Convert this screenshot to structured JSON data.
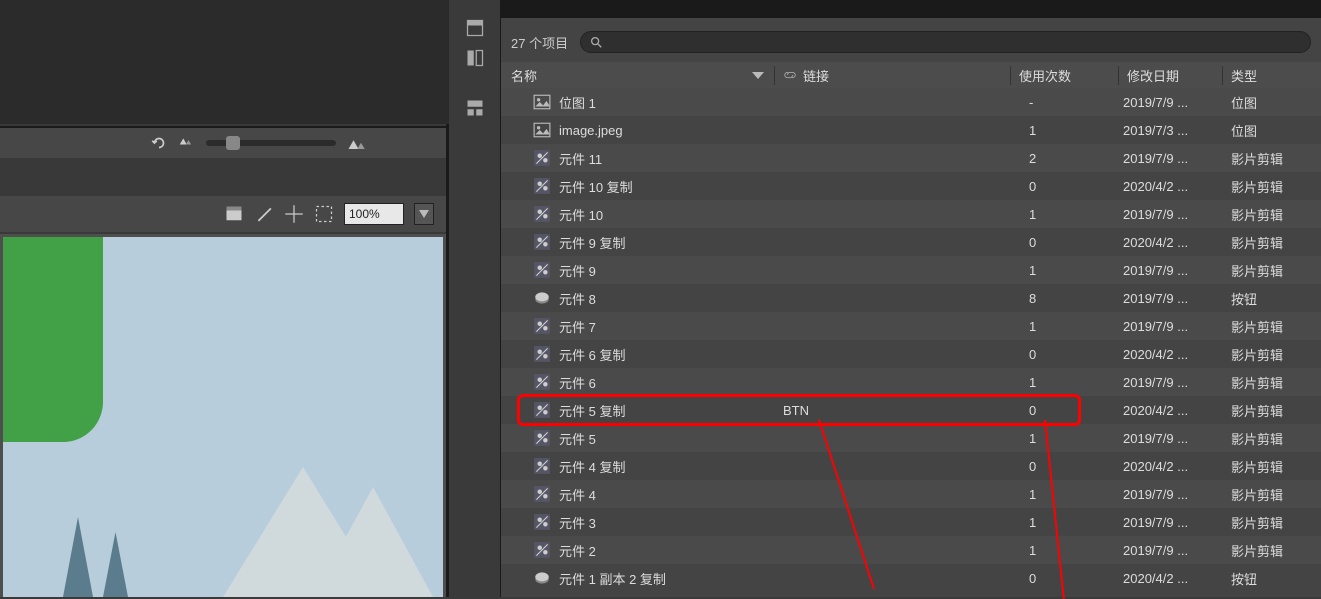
{
  "zoom": "100%",
  "library": {
    "item_count_label": "27 个项目",
    "search_placeholder": "",
    "columns": {
      "name": "名称",
      "link": "链接",
      "use": "使用次数",
      "date": "修改日期",
      "type": "类型"
    },
    "rows": [
      {
        "icon": "bitmap",
        "name": "位图 1",
        "link": "",
        "use": "-",
        "date": "2019/7/9 ...",
        "type": "位图"
      },
      {
        "icon": "bitmap",
        "name": "image.jpeg",
        "link": "",
        "use": "1",
        "date": "2019/7/3 ...",
        "type": "位图"
      },
      {
        "icon": "mc",
        "name": "元件 11",
        "link": "",
        "use": "2",
        "date": "2019/7/9 ...",
        "type": "影片剪辑"
      },
      {
        "icon": "mc",
        "name": "元件 10 复制",
        "link": "",
        "use": "0",
        "date": "2020/4/2 ...",
        "type": "影片剪辑"
      },
      {
        "icon": "mc",
        "name": "元件 10",
        "link": "",
        "use": "1",
        "date": "2019/7/9 ...",
        "type": "影片剪辑"
      },
      {
        "icon": "mc",
        "name": "元件 9 复制",
        "link": "",
        "use": "0",
        "date": "2020/4/2 ...",
        "type": "影片剪辑"
      },
      {
        "icon": "mc",
        "name": "元件 9",
        "link": "",
        "use": "1",
        "date": "2019/7/9 ...",
        "type": "影片剪辑"
      },
      {
        "icon": "btn",
        "name": "元件 8",
        "link": "",
        "use": "8",
        "date": "2019/7/9 ...",
        "type": "按钮"
      },
      {
        "icon": "mc",
        "name": "元件 7",
        "link": "",
        "use": "1",
        "date": "2019/7/9 ...",
        "type": "影片剪辑"
      },
      {
        "icon": "mc",
        "name": "元件 6 复制",
        "link": "",
        "use": "0",
        "date": "2020/4/2 ...",
        "type": "影片剪辑"
      },
      {
        "icon": "mc",
        "name": "元件 6",
        "link": "",
        "use": "1",
        "date": "2019/7/9 ...",
        "type": "影片剪辑"
      },
      {
        "icon": "mc",
        "name": "元件 5 复制",
        "link": "BTN",
        "use": "0",
        "date": "2020/4/2 ...",
        "type": "影片剪辑",
        "highlight": true
      },
      {
        "icon": "mc",
        "name": "元件 5",
        "link": "",
        "use": "1",
        "date": "2019/7/9 ...",
        "type": "影片剪辑"
      },
      {
        "icon": "mc",
        "name": "元件 4 复制",
        "link": "",
        "use": "0",
        "date": "2020/4/2 ...",
        "type": "影片剪辑"
      },
      {
        "icon": "mc",
        "name": "元件 4",
        "link": "",
        "use": "1",
        "date": "2019/7/9 ...",
        "type": "影片剪辑"
      },
      {
        "icon": "mc",
        "name": "元件 3",
        "link": "",
        "use": "1",
        "date": "2019/7/9 ...",
        "type": "影片剪辑"
      },
      {
        "icon": "mc",
        "name": "元件 2",
        "link": "",
        "use": "1",
        "date": "2019/7/9 ...",
        "type": "影片剪辑"
      },
      {
        "icon": "btn",
        "name": "元件 1 副本 2 复制",
        "link": "",
        "use": "0",
        "date": "2020/4/2 ...",
        "type": "按钮"
      }
    ]
  }
}
